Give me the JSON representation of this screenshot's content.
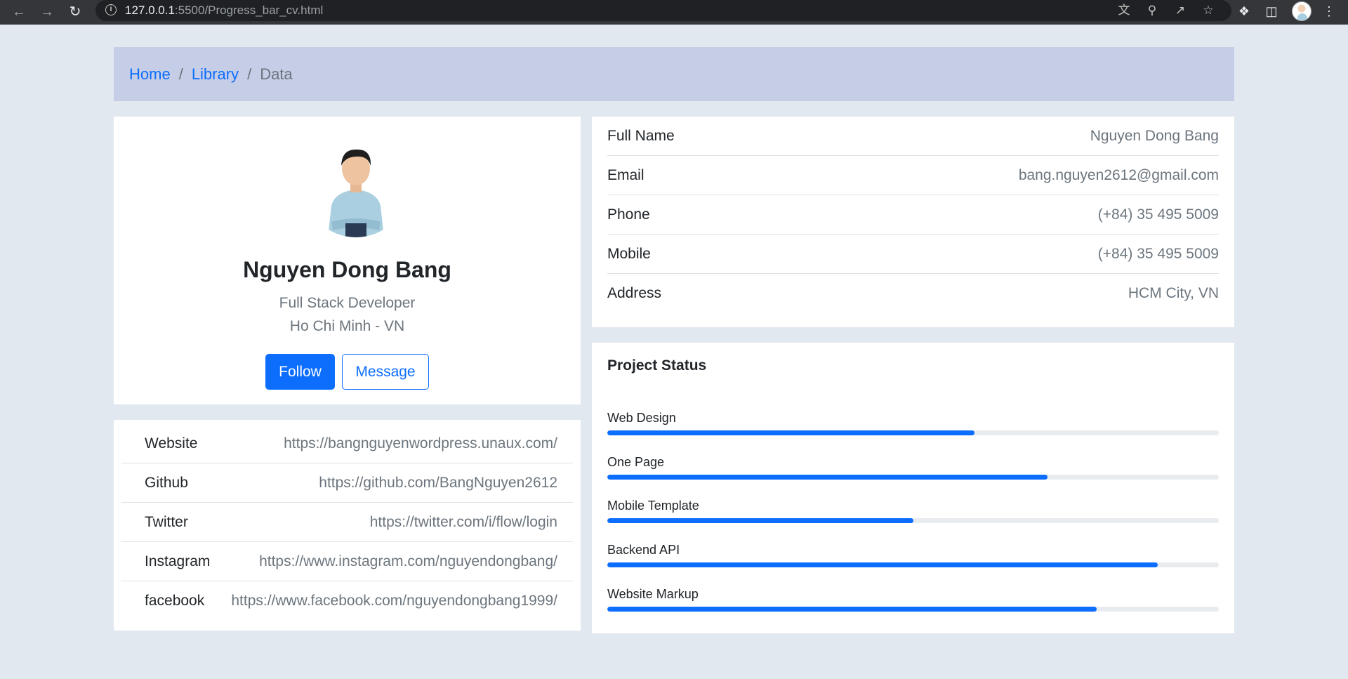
{
  "browser": {
    "url_host": "127.0.0.1",
    "url_rest": ":5500/Progress_bar_cv.html"
  },
  "breadcrumb": {
    "items": [
      "Home",
      "Library"
    ],
    "active": "Data",
    "separator": "/"
  },
  "profile": {
    "name": "Nguyen Dong Bang",
    "role": "Full Stack Developer",
    "location": "Ho Chi Minh - VN",
    "follow_label": "Follow",
    "message_label": "Message"
  },
  "social": [
    {
      "label": "Website",
      "value": "https://bangnguyenwordpress.unaux.com/"
    },
    {
      "label": "Github",
      "value": "https://github.com/BangNguyen2612"
    },
    {
      "label": "Twitter",
      "value": "https://twitter.com/i/flow/login"
    },
    {
      "label": "Instagram",
      "value": "https://www.instagram.com/nguyendongbang/"
    },
    {
      "label": "facebook",
      "value": "https://www.facebook.com/nguyendongbang1999/"
    }
  ],
  "info": [
    {
      "label": "Full Name",
      "value": "Nguyen Dong Bang"
    },
    {
      "label": "Email",
      "value": "bang.nguyen2612@gmail.com"
    },
    {
      "label": "Phone",
      "value": "(+84) 35 495 5009"
    },
    {
      "label": "Mobile",
      "value": "(+84) 35 495 5009"
    },
    {
      "label": "Address",
      "value": "HCM City, VN"
    }
  ],
  "project_status": {
    "title": "Project Status",
    "skills": [
      {
        "label": "Web Design",
        "percent": 60
      },
      {
        "label": "One Page",
        "percent": 72
      },
      {
        "label": "Mobile Template",
        "percent": 50
      },
      {
        "label": "Backend API",
        "percent": 90
      },
      {
        "label": "Website Markup",
        "percent": 80
      }
    ]
  },
  "colors": {
    "accent": "#0d6efd",
    "breadcrumb_bg": "#c5cde7",
    "page_bg": "#e2e8f0"
  },
  "icons": [
    "back-arrow-icon",
    "forward-arrow-icon",
    "reload-icon",
    "info-icon",
    "translate-icon",
    "zoom-icon",
    "share-icon",
    "bookmark-star-icon",
    "extensions-icon",
    "side-panel-icon",
    "menu-dots-icon"
  ]
}
